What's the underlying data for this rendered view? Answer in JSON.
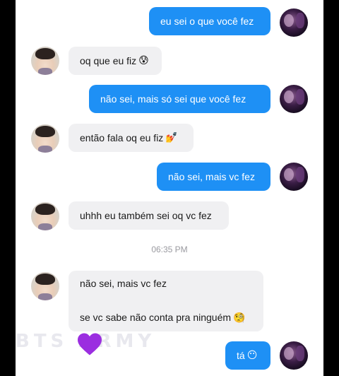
{
  "messages": [
    {
      "dir": "out",
      "text": "eu sei o que você  fez",
      "emoji": ""
    },
    {
      "dir": "in",
      "text": "oq que eu fiz",
      "emoji": "😰"
    },
    {
      "dir": "out",
      "text": "não  sei, mais só  sei que você  fez",
      "emoji": ""
    },
    {
      "dir": "in",
      "text": "então fala oq eu fiz",
      "emoji": "💅"
    },
    {
      "dir": "out",
      "text": "não  sei, mais vc fez",
      "emoji": ""
    },
    {
      "dir": "in",
      "text": "uhhh eu também sei oq vc fez",
      "emoji": ""
    },
    {
      "dir": "in",
      "text": "não  sei, mais vc fez",
      "text2": "se vc sabe não conta pra ninguém",
      "emoji": "🧐"
    },
    {
      "dir": "out",
      "text": "tá",
      "emoji": "😶"
    }
  ],
  "timestamp": "06:35 PM",
  "watermark": "BTS ARMY",
  "colors": {
    "outgoing": "#1e90f5",
    "incoming": "#f0f0f2",
    "heart": "#9b2ee0"
  }
}
